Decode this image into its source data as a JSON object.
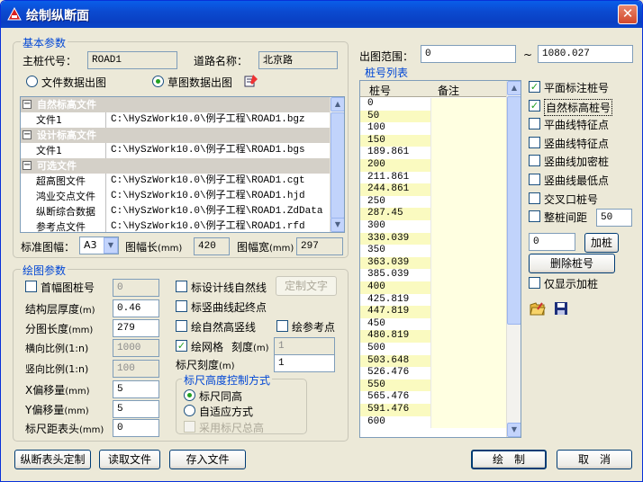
{
  "window": {
    "title": "绘制纵断面",
    "close": "✕"
  },
  "basic": {
    "group_label": "基本参数",
    "main_code_label": "主桩代号：",
    "main_code_value": "ROAD1",
    "road_name_label": "道路名称：",
    "road_name_value": "北京路",
    "radio_file": "文件数据出图",
    "radio_sketch": "草图数据出图",
    "radio_selected": "sketch"
  },
  "tree": {
    "sections": [
      {
        "title": "自然标高文件",
        "rows": [
          {
            "name": "文件1",
            "path": "C:\\HySzWork10.0\\例子工程\\ROAD1.bgz"
          }
        ]
      },
      {
        "title": "设计标高文件",
        "rows": [
          {
            "name": "文件1",
            "path": "C:\\HySzWork10.0\\例子工程\\ROAD1.bgs"
          }
        ]
      },
      {
        "title": "可选文件",
        "rows": [
          {
            "name": "超高图文件",
            "path": "C:\\HySzWork10.0\\例子工程\\ROAD1.cgt"
          },
          {
            "name": "鸿业交点文件",
            "path": "C:\\HySzWork10.0\\例子工程\\ROAD1.hjd"
          },
          {
            "name": "纵断综合数据",
            "path": "C:\\HySzWork10.0\\例子工程\\ROAD1.ZdData"
          },
          {
            "name": "参考点文件",
            "path": "C:\\HySzWork10.0\\例子工程\\ROAD1.rfd"
          }
        ]
      }
    ]
  },
  "paper": {
    "size_label": "标准图幅：",
    "size_value": "A3",
    "length_label": "图幅长",
    "length_unit": "(mm)",
    "length_value": "420",
    "width_label": "图幅宽",
    "width_unit": "(mm)",
    "width_value": "297"
  },
  "draw": {
    "group_label": "绘图参数",
    "first_pile_label": "首幅图桩号",
    "first_pile_value": "0",
    "layer_thick_label": "结构层厚度",
    "layer_thick_unit": "(m)",
    "layer_thick_value": "0.46",
    "seg_len_label": "分图长度",
    "seg_len_unit": "(mm)",
    "seg_len_value": "279",
    "h_scale_label": "横向比例(1:n)",
    "h_scale_value": "1000",
    "v_scale_label": "竖向比例(1:n)",
    "v_scale_value": "100",
    "x_offset_label": "X偏移量",
    "x_offset_unit": "(mm)",
    "x_offset_value": "5",
    "y_offset_label": "Y偏移量",
    "y_offset_unit": "(mm)",
    "y_offset_value": "5",
    "ruler_dist_label": "标尺距表头",
    "ruler_dist_unit": "(mm)",
    "ruler_dist_value": "0",
    "mark_design_label": "标设计线自然线",
    "custom_text_btn": "定制文字",
    "mark_curve_label": "标竖曲线起终点",
    "draw_natural_label": "绘自然高竖线",
    "draw_ref_label": "绘参考点",
    "draw_grid_label": "绘网格",
    "grid_scale_label": "刻度",
    "grid_scale_unit": "(m)",
    "grid_scale_value": "1",
    "ruler_scale_label": "标尺刻度",
    "ruler_scale_unit": "(m)",
    "ruler_scale_value": "1",
    "ruler_group_label": "标尺高度控制方式",
    "ruler_same": "标尺同高",
    "ruler_auto": "自适应方式",
    "ruler_total": "采用标尺总高"
  },
  "range": {
    "label": "出图范围：",
    "from": "0",
    "sep": "~",
    "to": "1080.027"
  },
  "pile_list": {
    "title": "桩号列表",
    "col_pile": "桩号",
    "col_note": "备注",
    "rows": [
      "0",
      "50",
      "100",
      "150",
      "189.861",
      "200",
      "211.861",
      "244.861",
      "250",
      "287.45",
      "300",
      "330.039",
      "350",
      "363.039",
      "385.039",
      "400",
      "425.819",
      "447.819",
      "450",
      "480.819",
      "500",
      "503.648",
      "526.476",
      "550",
      "565.476",
      "591.476",
      "600"
    ],
    "highlighted": [
      "50",
      "150",
      "200",
      "244.861",
      "287.45",
      "330.039",
      "363.039",
      "400",
      "447.819",
      "480.819",
      "503.648",
      "550",
      "591.476"
    ]
  },
  "options": {
    "plane_pile": "平面标注桩号",
    "natural_pile": "自然标高桩号",
    "plane_feature": "平曲线特征点",
    "vert_feature": "竖曲线特征点",
    "vert_dense": "竖曲线加密桩",
    "vert_low": "竖曲线最低点",
    "cross_pile": "交叉口桩号",
    "whole_pile": "整桩间距",
    "whole_pile_value": "50",
    "add_value": "0",
    "add_btn": "加桩",
    "delete_btn": "删除桩号",
    "show_added": "仅显示加桩"
  },
  "footer": {
    "custom_header_btn": "纵断表头定制",
    "read_file_btn": "读取文件",
    "save_file_btn": "存入文件",
    "draw_btn": "绘　制",
    "cancel_btn": "取　消"
  }
}
